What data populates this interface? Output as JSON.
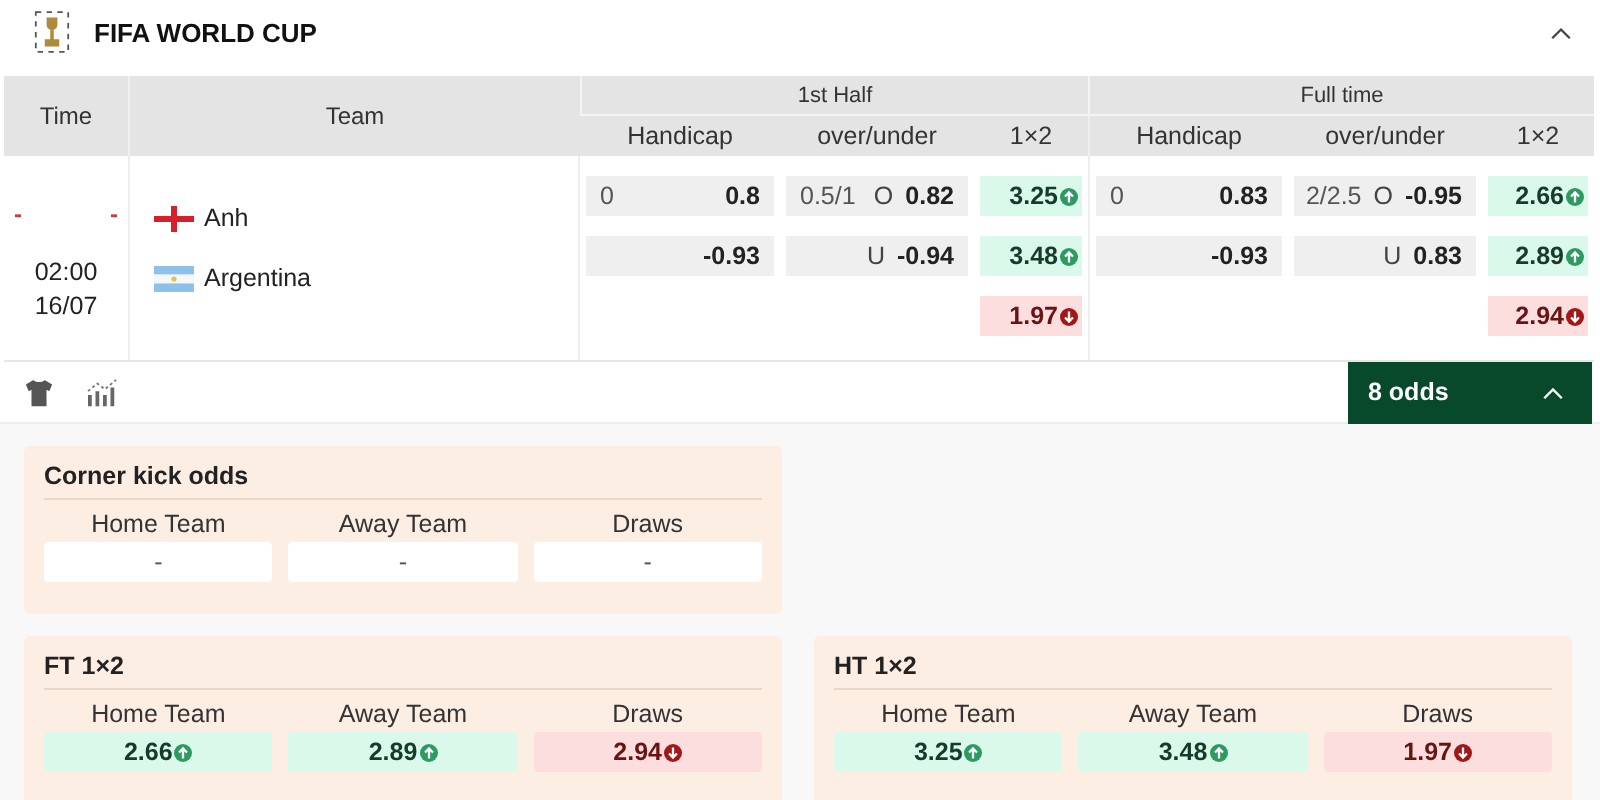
{
  "league": {
    "title": "FIFA WORLD CUP"
  },
  "table": {
    "time_header": "Time",
    "team_header": "Team"
  },
  "match": {
    "scores": [
      "-",
      "-"
    ],
    "time": "02:00",
    "date": "16/07",
    "teams": [
      {
        "name": "Anh",
        "kind": "england"
      },
      {
        "name": "Argentina",
        "kind": "argentina"
      }
    ]
  },
  "halves": [
    {
      "title": "1st Half",
      "columns": [
        "Handicap",
        "over/under",
        "1×2"
      ],
      "handicap": [
        {
          "line": "0",
          "value": "0.8"
        },
        {
          "value": "-0.93"
        }
      ],
      "over_under": [
        {
          "line": "0.5/1",
          "side": "O",
          "value": "0.82"
        },
        {
          "side": "U",
          "value": "-0.94"
        }
      ],
      "x12": [
        {
          "value": "3.25",
          "kind": "up"
        },
        {
          "value": "3.48",
          "kind": "up"
        },
        {
          "value": "1.97",
          "kind": "down"
        }
      ]
    },
    {
      "title": "Full time",
      "columns": [
        "Handicap",
        "over/under",
        "1×2"
      ],
      "handicap": [
        {
          "line": "0",
          "value": "0.83"
        },
        {
          "value": "-0.93"
        }
      ],
      "over_under": [
        {
          "line": "2/2.5",
          "side": "O",
          "value": "-0.95"
        },
        {
          "side": "U",
          "value": "0.83"
        }
      ],
      "x12": [
        {
          "value": "2.66",
          "kind": "up"
        },
        {
          "value": "2.89",
          "kind": "up"
        },
        {
          "value": "2.94",
          "kind": "down"
        }
      ]
    }
  ],
  "odds_button": {
    "label": "8 odds",
    "expanded": true
  },
  "markets": [
    {
      "title": "Corner kick odds",
      "columns": [
        "Home Team",
        "Away Team",
        "Draws"
      ],
      "cells": [
        {
          "value": "-"
        },
        {
          "value": "-"
        },
        {
          "value": "-"
        }
      ]
    },
    {
      "title": "FT 1×2",
      "columns": [
        "Home Team",
        "Away Team",
        "Draws"
      ],
      "cells": [
        {
          "value": "2.66",
          "kind": "up"
        },
        {
          "value": "2.89",
          "kind": "up"
        },
        {
          "value": "2.94",
          "kind": "down"
        }
      ]
    },
    {
      "title": "HT 1×2",
      "columns": [
        "Home Team",
        "Away Team",
        "Draws"
      ],
      "cells": [
        {
          "value": "3.25",
          "kind": "up"
        },
        {
          "value": "3.48",
          "kind": "up"
        },
        {
          "value": "1.97",
          "kind": "down"
        }
      ]
    }
  ]
}
